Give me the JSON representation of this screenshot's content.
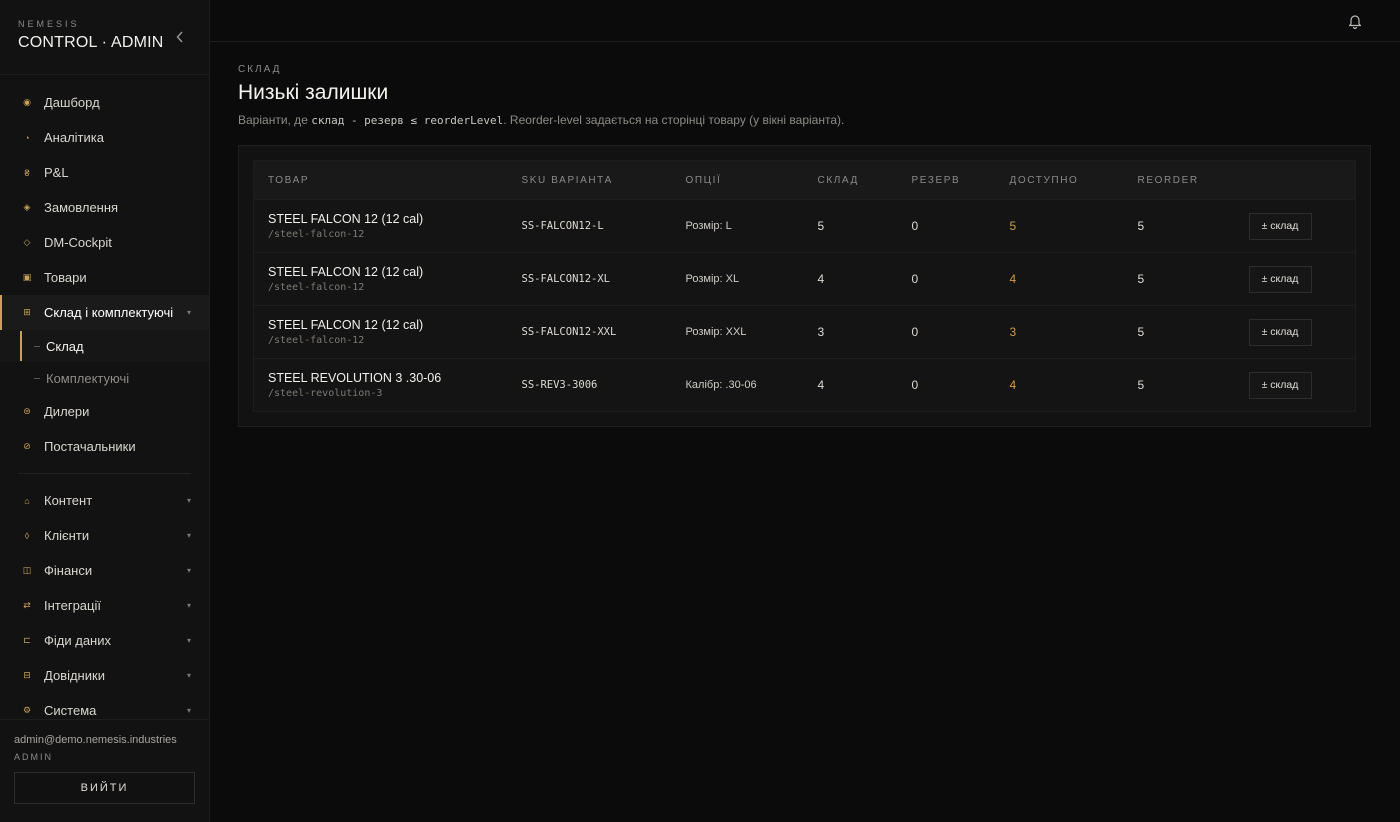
{
  "brand": {
    "top": "NEMESIS",
    "name": "CONTROL · ADMIN"
  },
  "nav": {
    "primary": [
      {
        "label": "Дашборд",
        "icon": "dashboard-icon",
        "glyph": "◉"
      },
      {
        "label": "Аналітика",
        "icon": "analytics-icon",
        "glyph": "◔"
      },
      {
        "label": "P&L",
        "icon": "pnl-icon",
        "glyph": "₴"
      },
      {
        "label": "Замовлення",
        "icon": "orders-icon",
        "glyph": "◈"
      },
      {
        "label": "DM-Cockpit",
        "icon": "cockpit-icon",
        "glyph": "◇"
      },
      {
        "label": "Товари",
        "icon": "products-icon",
        "glyph": "▣"
      },
      {
        "label": "Склад і комплектуючі",
        "icon": "warehouse-icon",
        "glyph": "⊞"
      }
    ],
    "warehouse_sub": [
      {
        "label": "Склад"
      },
      {
        "label": "Комплектуючі"
      }
    ],
    "after": [
      {
        "label": "Дилери",
        "icon": "dealers-icon",
        "glyph": "⊜"
      },
      {
        "label": "Постачальники",
        "icon": "suppliers-icon",
        "glyph": "⊘"
      }
    ],
    "groups": [
      {
        "label": "Контент",
        "icon": "content-icon",
        "glyph": "⌂"
      },
      {
        "label": "Клієнти",
        "icon": "clients-icon",
        "glyph": "◊"
      },
      {
        "label": "Фінанси",
        "icon": "finance-icon",
        "glyph": "◫"
      },
      {
        "label": "Інтеграції",
        "icon": "integrations-icon",
        "glyph": "⇄"
      },
      {
        "label": "Фіди даних",
        "icon": "feeds-icon",
        "glyph": "⊏"
      },
      {
        "label": "Довідники",
        "icon": "directories-icon",
        "glyph": "⊟"
      },
      {
        "label": "Система",
        "icon": "system-icon",
        "glyph": "⚙"
      }
    ]
  },
  "user": {
    "email": "admin@demo.nemesis.industries",
    "role": "ADMIN",
    "logout": "ВИЙТИ"
  },
  "page": {
    "eyebrow": "СКЛАД",
    "title": "Низькі залишки",
    "desc_prefix": "Варіанти, де ",
    "desc_code": "склад - резерв ≤ reorderLevel",
    "desc_suffix": ". Reorder-level задається на сторінці товару (у вікні варіанта)."
  },
  "table": {
    "headers": {
      "product": "ТОВАР",
      "sku": "SKU ВАРІАНТА",
      "options": "ОПЦІЇ",
      "stock": "СКЛАД",
      "reserve": "РЕЗЕРВ",
      "available": "ДОСТУПНО",
      "reorder": "REORDER"
    },
    "action_label": "± склад",
    "rows": [
      {
        "name": "STEEL FALCON 12 (12 cal)",
        "slug": "/steel-falcon-12",
        "sku": "SS-FALCON12-L",
        "options": "Розмір: L",
        "stock": "5",
        "reserve": "0",
        "available": "5",
        "reorder": "5"
      },
      {
        "name": "STEEL FALCON 12 (12 cal)",
        "slug": "/steel-falcon-12",
        "sku": "SS-FALCON12-XL",
        "options": "Розмір: XL",
        "stock": "4",
        "reserve": "0",
        "available": "4",
        "reorder": "5"
      },
      {
        "name": "STEEL FALCON 12 (12 cal)",
        "slug": "/steel-falcon-12",
        "sku": "SS-FALCON12-XXL",
        "options": "Розмір: XXL",
        "stock": "3",
        "reserve": "0",
        "available": "3",
        "reorder": "5"
      },
      {
        "name": "STEEL REVOLUTION 3 .30-06",
        "slug": "/steel-revolution-3",
        "sku": "SS-REV3-3006",
        "options": "Калібр: .30-06",
        "stock": "4",
        "reserve": "0",
        "available": "4",
        "reorder": "5"
      }
    ]
  },
  "colors": {
    "accent": "#c9a25a",
    "available": "#d49a3e",
    "bg": "#0b0b0b",
    "sidebar": "#121212"
  }
}
